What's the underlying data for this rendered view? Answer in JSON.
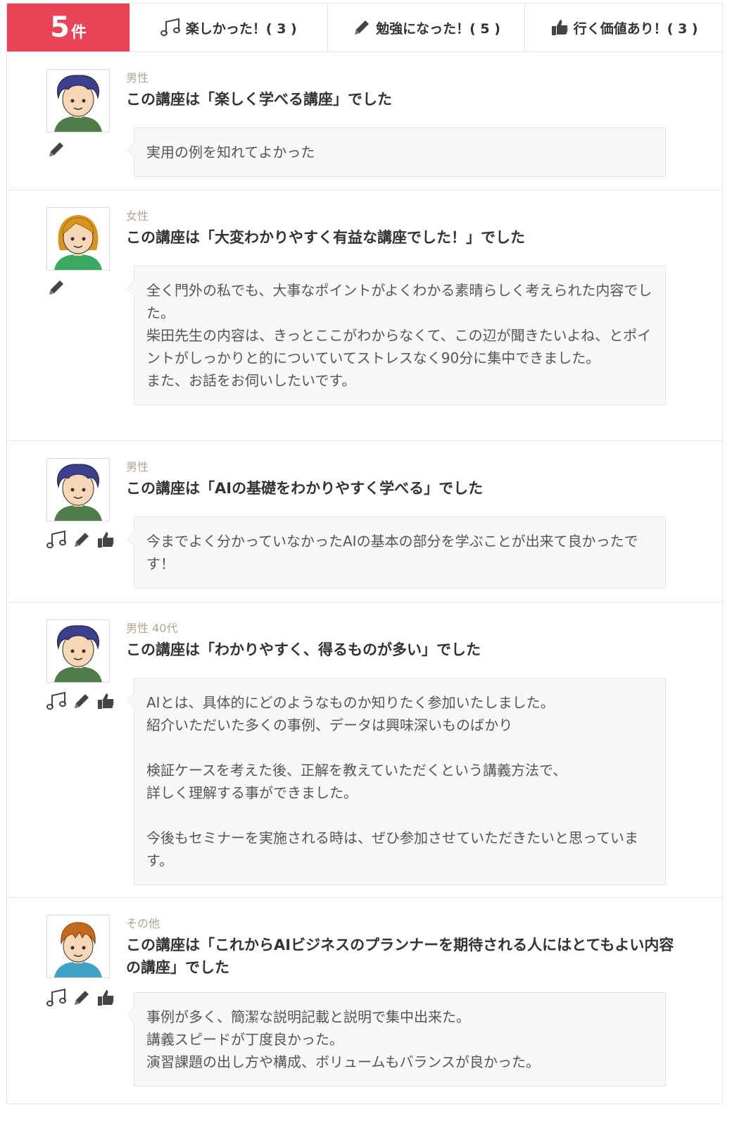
{
  "header": {
    "count": "5",
    "count_unit": "件",
    "tabs": [
      {
        "label": "楽しかった！( 3 )",
        "icon": "music-note-icon"
      },
      {
        "label": "勉強になった！( 5 )",
        "icon": "pencil-icon"
      },
      {
        "label": "行く価値あり！( 3 )",
        "icon": "thumbs-up-icon"
      }
    ]
  },
  "reviews": [
    {
      "meta": "男性",
      "title": "この講座は「楽しく学べる講座」でした",
      "comment": "実用の例を知れてよかった",
      "icons": [
        "pencil-icon"
      ],
      "avatar": "male-curly"
    },
    {
      "meta": "女性",
      "title": "この講座は「大変わかりやすく有益な講座でした！」でした",
      "comment": "全く門外の私でも、大事なポイントがよくわかる素晴らしく考えられた内容でした。\n柴田先生の内容は、きっとここがわからなくて、この辺が聞きたいよね、とポイントがしっかりと的についていてストレスなく90分に集中できました。\nまた、お話をお伺いしたいです。",
      "icons": [
        "pencil-icon"
      ],
      "avatar": "female"
    },
    {
      "meta": "男性",
      "title": "この講座は「AIの基礎をわかりやすく学べる」でした",
      "comment": "今までよく分かっていなかったAIの基本の部分を学ぶことが出来て良かったです！",
      "icons": [
        "music-note-icon",
        "pencil-icon",
        "thumbs-up-icon"
      ],
      "avatar": "male-curly"
    },
    {
      "meta": "男性 40代",
      "title": "この講座は「わかりやすく、得るものが多い」でした",
      "comment": "AIとは、具体的にどのようなものか知りたく参加いたしました。\n紹介いただいた多くの事例、データは興味深いものばかり\n\n検証ケースを考えた後、正解を教えていただくという講義方法で、\n詳しく理解する事ができました。\n\n今後もセミナーを実施される時は、ぜひ参加させていただきたいと思っています。",
      "icons": [
        "music-note-icon",
        "pencil-icon",
        "thumbs-up-icon"
      ],
      "avatar": "male-curly"
    },
    {
      "meta": "その他",
      "title": "この講座は「これからAIビジネスのプランナーを期待される人にはとてもよい内容の講座」でした",
      "comment": "事例が多く、簡潔な説明記載と説明で集中出来た。\n講義スピードが丁度良かった。\n演習課題の出し方や構成、ボリュームもバランスが良かった。",
      "icons": [
        "music-note-icon",
        "pencil-icon",
        "thumbs-up-icon"
      ],
      "avatar": "other"
    }
  ]
}
